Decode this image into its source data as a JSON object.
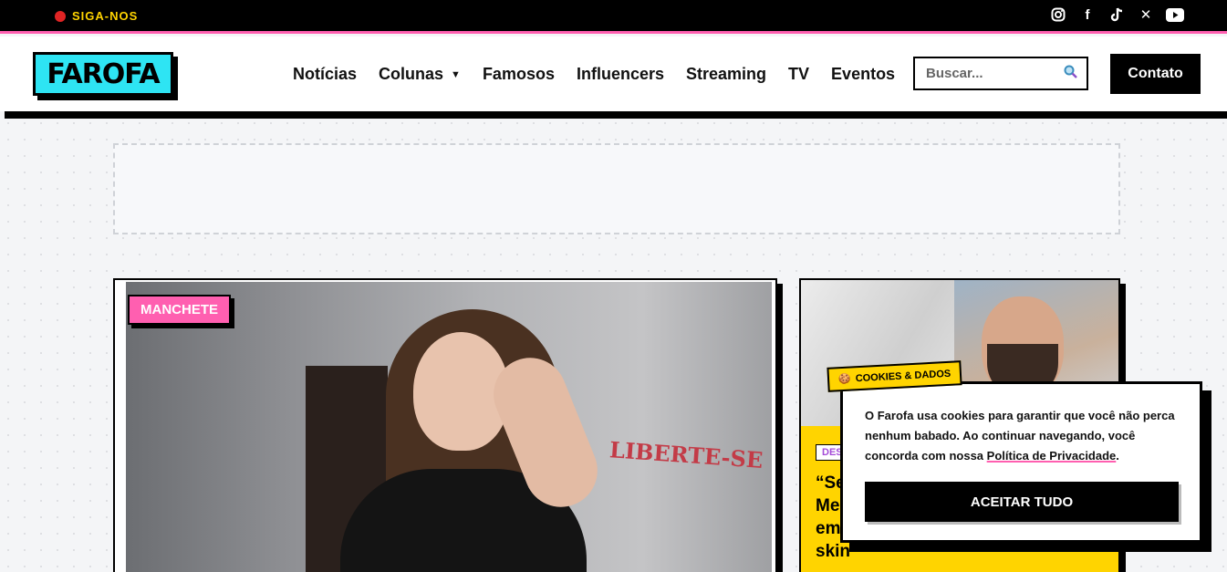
{
  "topbar": {
    "follow_label": "SIGA-NOS",
    "socials": [
      "instagram-icon",
      "facebook-icon",
      "tiktok-icon",
      "x-icon",
      "youtube-icon"
    ],
    "accent": "#ff5fb0"
  },
  "header": {
    "logo": "FAROFA",
    "nav": [
      {
        "label": "Notícias"
      },
      {
        "label": "Colunas",
        "has_dropdown": true
      },
      {
        "label": "Famosos"
      },
      {
        "label": "Influencers"
      },
      {
        "label": "Streaming"
      },
      {
        "label": "TV"
      },
      {
        "label": "Eventos"
      }
    ],
    "search_placeholder": "Buscar...",
    "contact_label": "Contato"
  },
  "main_story": {
    "badge": "MANCHETE",
    "image_sign": "LIBERTE-SE"
  },
  "side_story": {
    "tag": "DES",
    "title_fragment": "“Se\nMe\nem\nskin"
  },
  "cookie": {
    "tag": "COOKIES & DADOS",
    "text_before": "O Farofa usa cookies para garantir que você não perca nenhum babado. Ao continuar navegando, você concorda com nossa ",
    "link": "Política de Privacidade",
    "text_after": ".",
    "accept": "ACEITAR TUDO"
  },
  "colors": {
    "logo_bg": "#2ee4f3",
    "yellow": "#ffd400",
    "pink": "#ff5fb0"
  }
}
